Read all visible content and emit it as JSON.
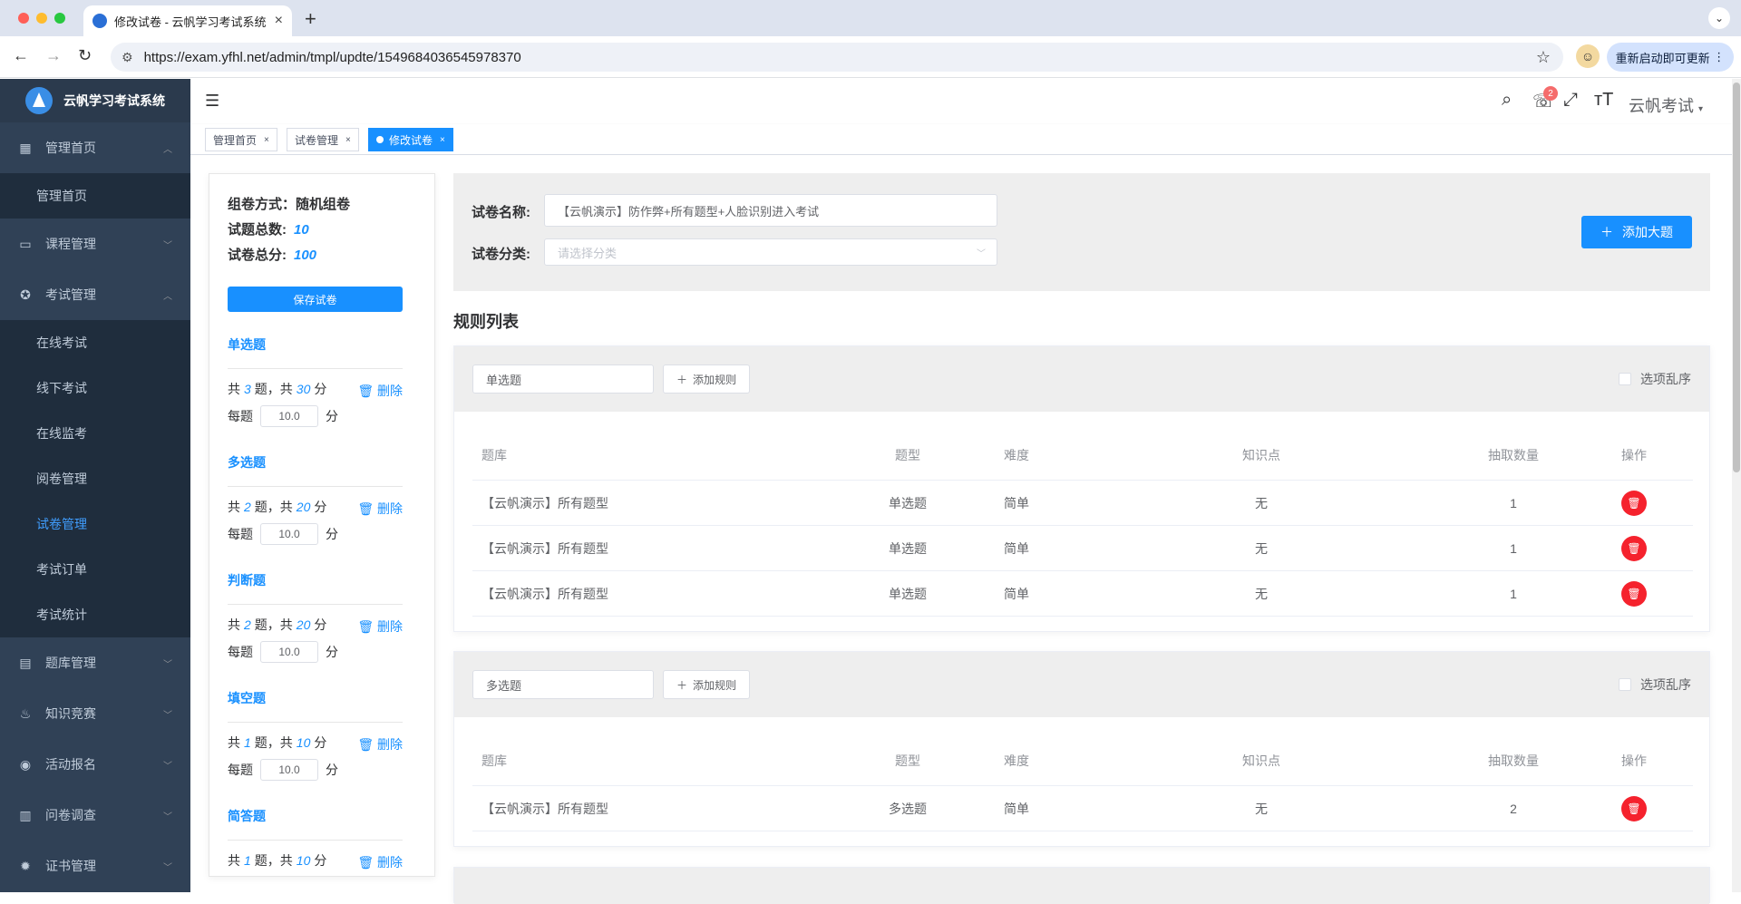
{
  "browser": {
    "tab_title": "修改试卷 - 云帆学习考试系统",
    "url": "https://exam.yfhl.net/admin/tmpl/updte/1549684036545978370",
    "relaunch_label": "重新启动即可更新"
  },
  "sidebar": {
    "logo_text": "云帆学习考试系统",
    "menu": [
      {
        "label": "管理首页",
        "icon": "dashboard-icon"
      },
      {
        "label": "课程管理",
        "icon": "monitor-icon"
      },
      {
        "label": "考试管理",
        "icon": "exam-icon"
      },
      {
        "label": "题库管理",
        "icon": "document-icon"
      },
      {
        "label": "知识竞赛",
        "icon": "fire-icon"
      },
      {
        "label": "活动报名",
        "icon": "target-icon"
      },
      {
        "label": "问卷调查",
        "icon": "book-icon"
      },
      {
        "label": "证书管理",
        "icon": "gear-icon"
      }
    ],
    "sub_home": [
      "管理首页"
    ],
    "sub_exam": [
      "在线考试",
      "线下考试",
      "在线监考",
      "阅卷管理",
      "试卷管理",
      "考试订单",
      "考试统计"
    ]
  },
  "header": {
    "badge": "2",
    "user_name": "云帆考试"
  },
  "tags": [
    {
      "label": "管理首页"
    },
    {
      "label": "试卷管理"
    },
    {
      "label": "修改试卷"
    }
  ],
  "summary": {
    "method_label": "组卷方式：",
    "method_value": "随机组卷",
    "total_q_label": "试题总数:",
    "total_q_value": "10",
    "total_score_label": "试卷总分:",
    "total_score_value": "100",
    "save_label": "保存试卷"
  },
  "question_types": [
    {
      "title": "单选题",
      "count": "3",
      "score": "30",
      "per": "10.0"
    },
    {
      "title": "多选题",
      "count": "2",
      "score": "20",
      "per": "10.0"
    },
    {
      "title": "判断题",
      "count": "2",
      "score": "20",
      "per": "10.0"
    },
    {
      "title": "填空题",
      "count": "1",
      "score": "10",
      "per": "10.0"
    },
    {
      "title": "简答题",
      "count": "1",
      "score": "10",
      "per": ""
    }
  ],
  "qt_text": {
    "gong": "共",
    "ti": "题，共",
    "fen": "分",
    "each": "每题",
    "delete": "删除"
  },
  "form": {
    "name_label": "试卷名称:",
    "name_value": "【云帆演示】防作弊+所有题型+人脸识别进入考试",
    "category_label": "试卷分类:",
    "category_placeholder": "请选择分类",
    "add_big_label": "添加大题"
  },
  "rules": {
    "title": "规则列表",
    "add_rule_label": "添加规则",
    "shuffle_label": "选项乱序",
    "columns": [
      "题库",
      "题型",
      "难度",
      "知识点",
      "抽取数量",
      "操作"
    ],
    "groups": [
      {
        "type": "单选题",
        "rows": [
          [
            "【云帆演示】所有题型",
            "单选题",
            "简单",
            "无",
            "1"
          ],
          [
            "【云帆演示】所有题型",
            "单选题",
            "简单",
            "无",
            "1"
          ],
          [
            "【云帆演示】所有题型",
            "单选题",
            "简单",
            "无",
            "1"
          ]
        ]
      },
      {
        "type": "多选题",
        "rows": [
          [
            "【云帆演示】所有题型",
            "多选题",
            "简单",
            "无",
            "2"
          ]
        ]
      }
    ]
  },
  "colors": {
    "primary": "#1890ff",
    "sidebar": "#304156",
    "danger": "#f5222d"
  }
}
